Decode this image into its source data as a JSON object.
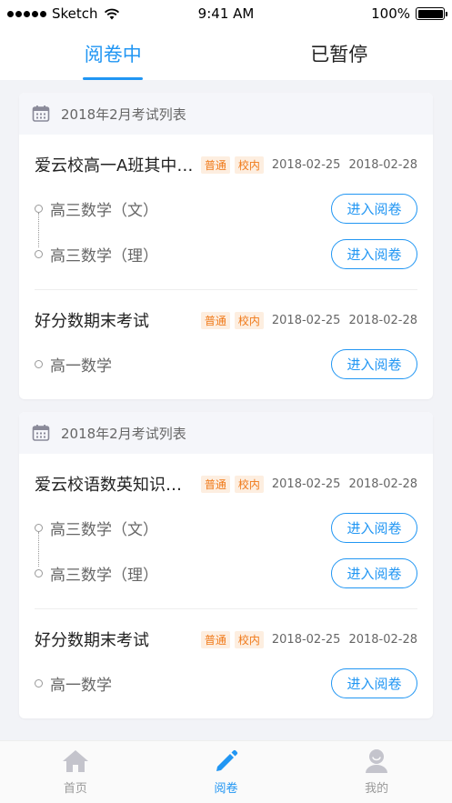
{
  "status_bar": {
    "carrier": "Sketch",
    "time": "9:41 AM",
    "battery": "100%"
  },
  "tabs": [
    {
      "label": "阅卷中",
      "active": true
    },
    {
      "label": "已暂停",
      "active": false
    }
  ],
  "groups": [
    {
      "header": "2018年2月考试列表",
      "exams": [
        {
          "title": "爱云校高一A班其中考试",
          "tags": [
            "普通",
            "校内"
          ],
          "start_date": "2018-02-25",
          "end_date": "2018-02-28",
          "subjects": [
            {
              "name": "高三数学（文）",
              "button": "进入阅卷"
            },
            {
              "name": "高三数学（理）",
              "button": "进入阅卷"
            }
          ]
        },
        {
          "title": "好分数期末考试",
          "tags": [
            "普通",
            "校内"
          ],
          "start_date": "2018-02-25",
          "end_date": "2018-02-28",
          "subjects": [
            {
              "name": "高一数学",
              "button": "进入阅卷"
            }
          ]
        }
      ]
    },
    {
      "header": "2018年2月考试列表",
      "exams": [
        {
          "title": "爱云校语数英知识竞赛",
          "tags": [
            "普通",
            "校内"
          ],
          "start_date": "2018-02-25",
          "end_date": "2018-02-28",
          "subjects": [
            {
              "name": "高三数学（文）",
              "button": "进入阅卷"
            },
            {
              "name": "高三数学（理）",
              "button": "进入阅卷"
            }
          ]
        },
        {
          "title": "好分数期末考试",
          "tags": [
            "普通",
            "校内"
          ],
          "start_date": "2018-02-25",
          "end_date": "2018-02-28",
          "subjects": [
            {
              "name": "高一数学",
              "button": "进入阅卷"
            }
          ]
        }
      ]
    }
  ],
  "bottom_nav": [
    {
      "label": "首页",
      "icon": "home-icon",
      "active": false
    },
    {
      "label": "阅卷",
      "icon": "pencil-icon",
      "active": true
    },
    {
      "label": "我的",
      "icon": "user-icon",
      "active": false
    }
  ],
  "colors": {
    "accent": "#2196f3",
    "tag_text": "#f07a1a",
    "tag_bg": "#fdeee0",
    "background": "#f2f3f7"
  }
}
